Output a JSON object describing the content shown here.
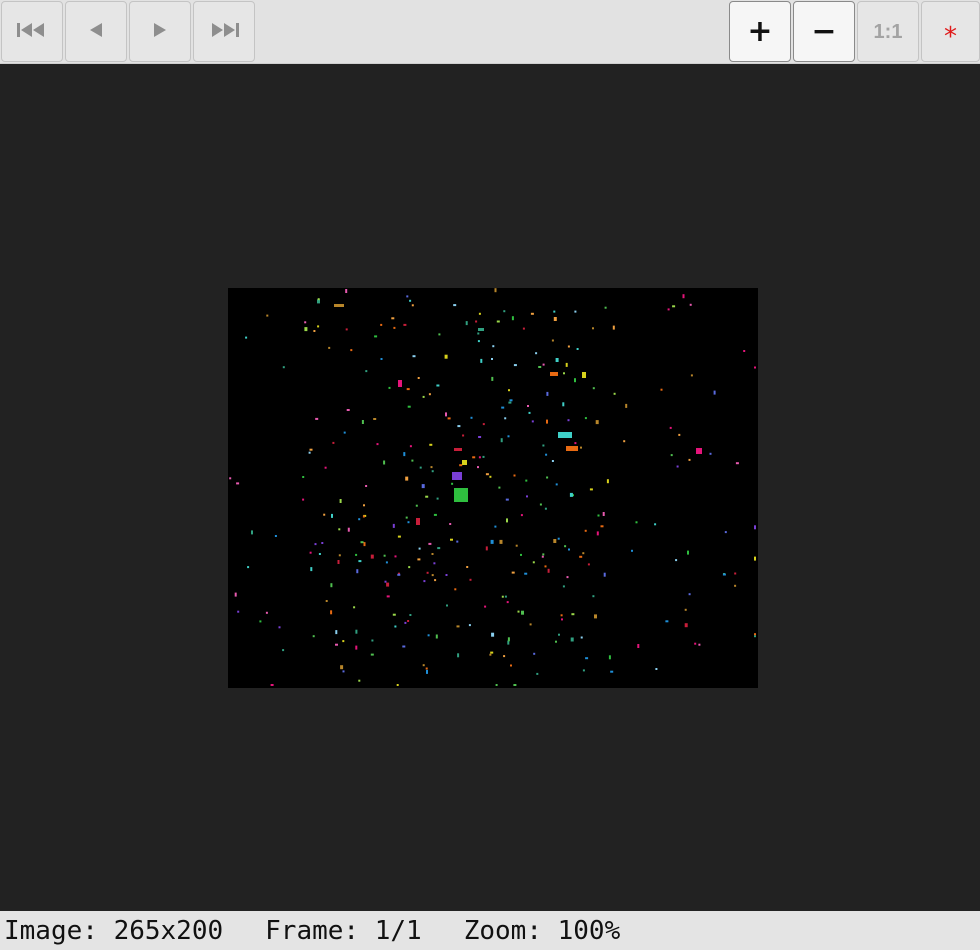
{
  "toolbar": {
    "nav_buttons": [
      {
        "icon": "skip-to-first-icon",
        "glyph": "⏮"
      },
      {
        "icon": "previous-icon",
        "glyph": "◀"
      },
      {
        "icon": "next-icon",
        "glyph": "▶"
      },
      {
        "icon": "skip-to-last-icon",
        "glyph": "⏭"
      }
    ],
    "zoom_in_label": "+",
    "zoom_out_label": "−",
    "actual_size_label": "1:1",
    "reset_label": "*"
  },
  "colors": {
    "viewport_bg": "#222222",
    "image_bg": "#000000",
    "toolbar_bg": "#e2e2e2",
    "reset_star": "#e01a1a"
  },
  "status": {
    "image": "Image: 265x200",
    "frame": "Frame: 1/1",
    "zoom": "Zoom: 100%"
  }
}
